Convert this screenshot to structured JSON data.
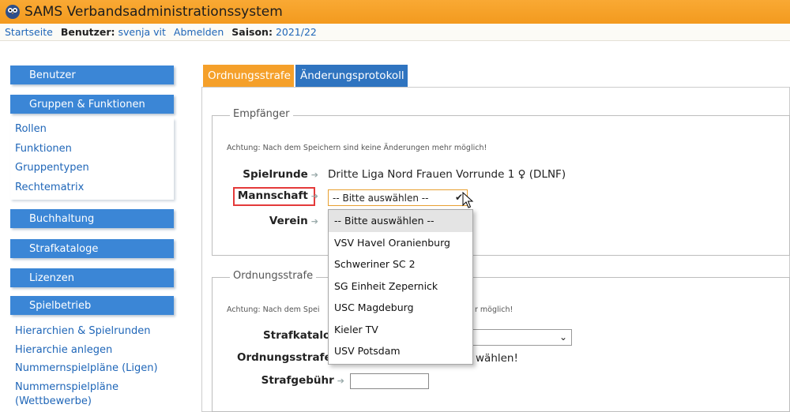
{
  "app": {
    "title": "SAMS Verbandsadministrationssystem"
  },
  "nav": {
    "home": "Startseite",
    "user_label": "Benutzer:",
    "user_name": "svenja vit",
    "logout": "Abmelden",
    "season_label": "Saison:",
    "season_value": "2021/22"
  },
  "sidebar": {
    "benutzer": "Benutzer",
    "gruppen": "Gruppen & Funktionen",
    "gruppen_items": [
      "Rollen",
      "Funktionen",
      "Gruppentypen",
      "Rechtematrix"
    ],
    "buchhaltung": "Buchhaltung",
    "strafkataloge": "Strafkataloge",
    "lizenzen": "Lizenzen",
    "spielbetrieb": "Spielbetrieb",
    "spielbetrieb_items": [
      "Hierarchien & Spielrunden",
      "Hierarchie anlegen",
      "Nummernspielpläne (Ligen)",
      "Nummernspielpläne",
      "(Wettbewerbe)"
    ]
  },
  "tabs": {
    "active": "Ordnungsstrafe",
    "other": "Änderungsprotokoll"
  },
  "empfaenger": {
    "legend": "Empfänger",
    "note": "Achtung: Nach dem Speichern sind keine Änderungen mehr möglich!",
    "spielrunde_label": "Spielrunde",
    "spielrunde_value": "Dritte Liga Nord Frauen Vorrunde 1 ♀ (DLNF)",
    "mannschaft_label": "Mannschaft",
    "mannschaft_selected": "-- Bitte auswählen --",
    "verein_label": "Verein"
  },
  "ordnungsstrafe": {
    "legend": "Ordnungsstrafe",
    "note_start": "Achtung: Nach dem Spei",
    "note_end": "r möglich!",
    "strafkatalog_label": "Strafkatalog",
    "ordnungsstrafe_label": "Ordnungsstrafe",
    "ordnungsstrafe_tail": "wählen!",
    "strafgebuehr_label": "Strafgebühr"
  },
  "dropdown": {
    "options": [
      "-- Bitte auswählen --",
      "VSV Havel Oranienburg",
      "Schweriner SC 2",
      "SG Einheit Zepernick",
      "USC Magdeburg",
      "Kieler TV",
      "USV Potsdam"
    ]
  },
  "colors": {
    "header": "#f5a02a",
    "primary": "#3b86d6",
    "link": "#1f66b8",
    "highlight": "#e43a3a"
  }
}
